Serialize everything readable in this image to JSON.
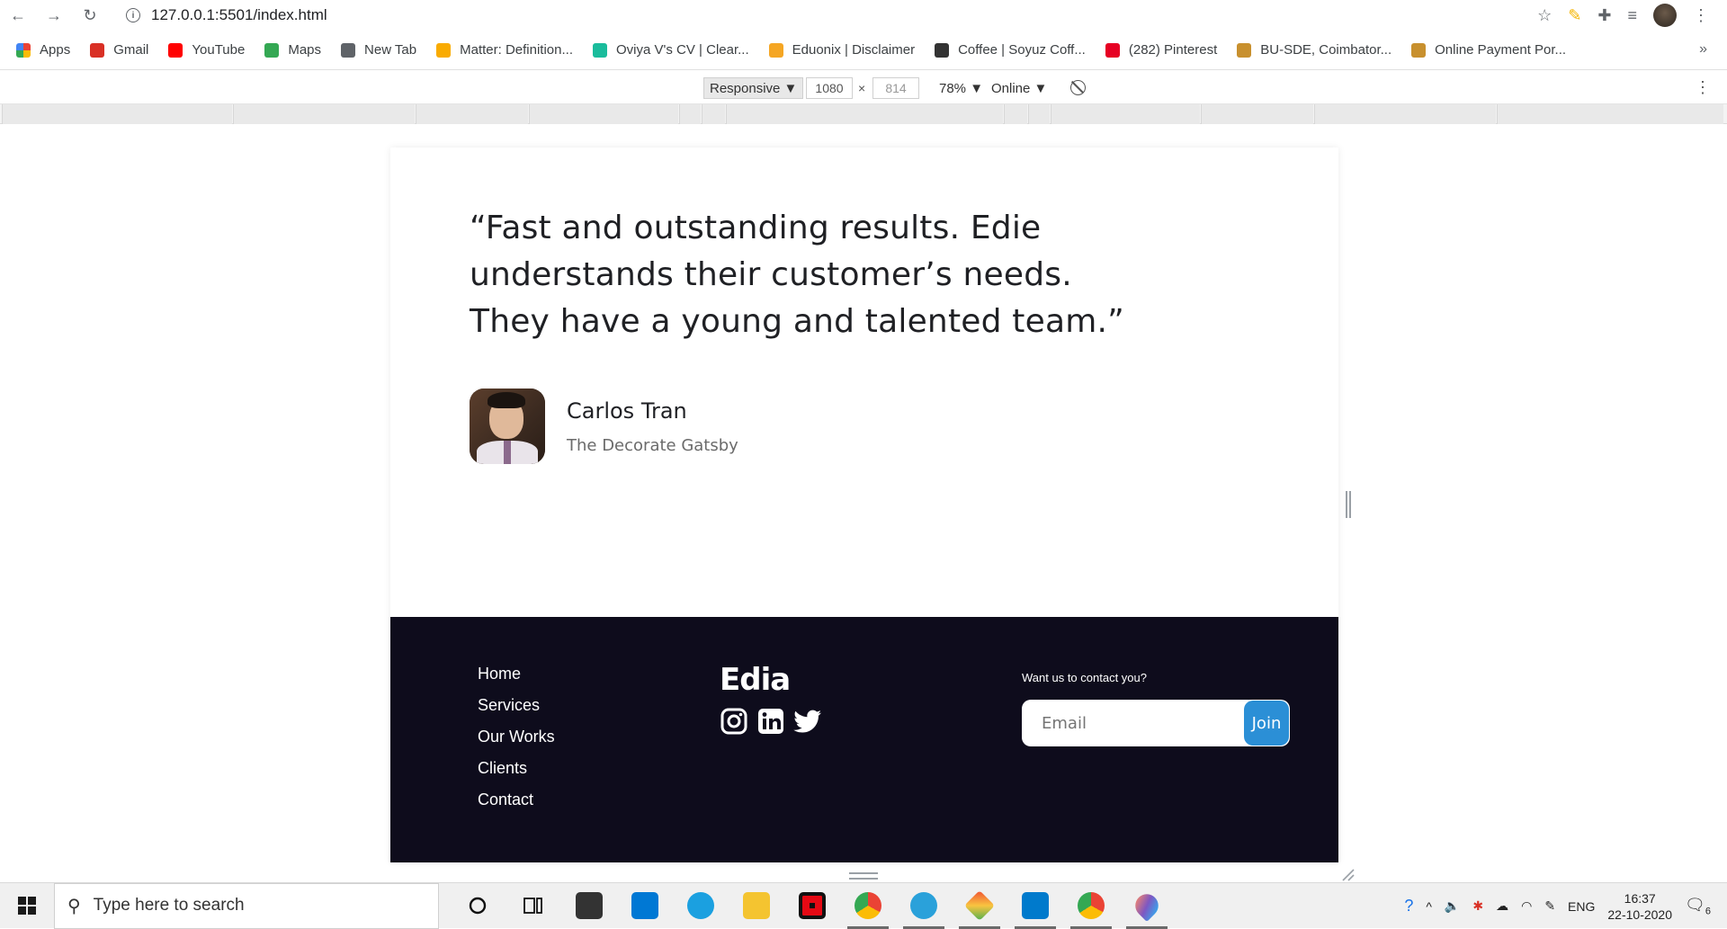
{
  "browser": {
    "url": "127.0.0.1:5501/index.html",
    "bookmarks": [
      {
        "label": "Apps",
        "color": "#ea4335"
      },
      {
        "label": "Gmail",
        "color": "#d93025"
      },
      {
        "label": "YouTube",
        "color": "#ff0000"
      },
      {
        "label": "Maps",
        "color": "#34a853"
      },
      {
        "label": "New Tab",
        "color": "#5f6368"
      },
      {
        "label": "Matter: Definition...",
        "color": "#f9ab00"
      },
      {
        "label": "Oviya V's CV | Clear...",
        "color": "#1abc9c"
      },
      {
        "label": "Eduonix | Disclaimer",
        "color": "#f5a623"
      },
      {
        "label": "Coffee | Soyuz Coff...",
        "color": "#333333"
      },
      {
        "label": "(282) Pinterest",
        "color": "#e60023"
      },
      {
        "label": "BU-SDE, Coimbator...",
        "color": "#c8902e"
      },
      {
        "label": "Online Payment Por...",
        "color": "#c8902e"
      }
    ]
  },
  "devtools": {
    "device": "Responsive ▼",
    "width": "1080",
    "height": "814",
    "zoom": "78% ▼",
    "throttle": "Online ▼"
  },
  "testimonial": {
    "quote_line1": "“Fast and outstanding results. Edie",
    "quote_line2": "understands their customer’s needs.",
    "quote_line3": "They have a young and talented team.”",
    "author_name": "Carlos Tran",
    "author_company": "The Decorate Gatsby"
  },
  "footer": {
    "links": [
      "Home",
      "Services",
      "Our Works",
      "Clients",
      "Contact"
    ],
    "brand": "Edia",
    "contact_label": "Want us to contact you?",
    "email_placeholder": "Email",
    "join_label": "Join",
    "colors": {
      "background": "#0e0c1c",
      "join": "#2b8fd6"
    }
  },
  "taskbar": {
    "search_placeholder": "Type here to search",
    "language": "ENG",
    "time": "16:37",
    "date": "22-10-2020",
    "notifications": "6"
  }
}
